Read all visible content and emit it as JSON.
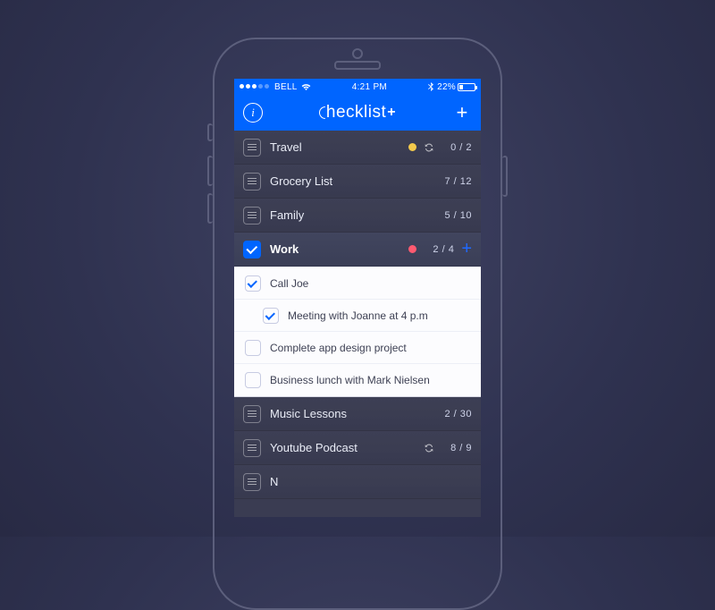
{
  "status": {
    "carrier": "BELL",
    "time": "4:21 PM",
    "battery_pct": "22%"
  },
  "nav": {
    "brand": "hecklist",
    "brand_suffix": "+",
    "info_glyph": "i",
    "add_glyph": "+"
  },
  "lists": [
    {
      "title": "Travel",
      "count": "0 / 2",
      "dot_color": "#f2c94c",
      "has_sync": true,
      "selected": false
    },
    {
      "title": "Grocery List",
      "count": "7 / 12",
      "dot_color": null,
      "has_sync": false,
      "selected": false
    },
    {
      "title": "Family",
      "count": "5 / 10",
      "dot_color": null,
      "has_sync": false,
      "selected": false
    },
    {
      "title": "Work",
      "count": "2 / 4",
      "dot_color": "#ff5a70",
      "has_sync": false,
      "selected": true,
      "tasks": [
        {
          "label": "Call Joe",
          "checked": true,
          "indent": false
        },
        {
          "label": "Meeting with Joanne at 4 p.m",
          "checked": true,
          "indent": true
        },
        {
          "label": "Complete app design project",
          "checked": false,
          "indent": false
        },
        {
          "label": "Business lunch with Mark Nielsen",
          "checked": false,
          "indent": false
        }
      ]
    },
    {
      "title": "Music Lessons",
      "count": "2 / 30",
      "dot_color": null,
      "has_sync": false,
      "selected": false
    },
    {
      "title": "Youtube Podcast",
      "count": "8 / 9",
      "dot_color": null,
      "has_sync": true,
      "selected": false
    },
    {
      "title": "N",
      "count": "",
      "dot_color": null,
      "has_sync": false,
      "selected": false
    }
  ]
}
